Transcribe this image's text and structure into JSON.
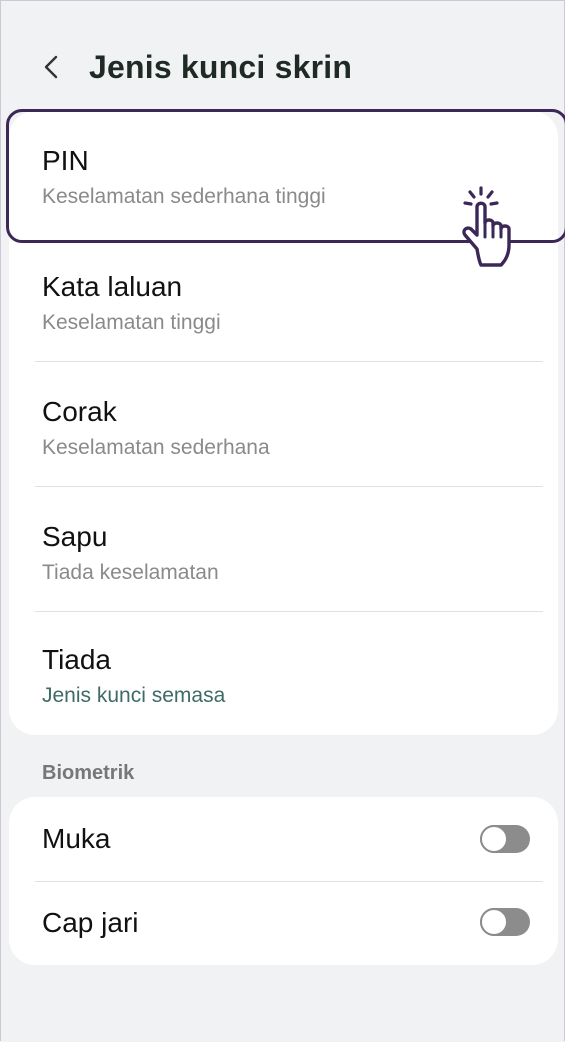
{
  "header": {
    "title": "Jenis kunci skrin",
    "back_icon": "chevron-left-icon"
  },
  "lock_options": [
    {
      "title": "PIN",
      "subtitle": "Keselamatan sederhana tinggi"
    },
    {
      "title": "Kata laluan",
      "subtitle": "Keselamatan tinggi"
    },
    {
      "title": "Corak",
      "subtitle": "Keselamatan sederhana"
    },
    {
      "title": "Sapu",
      "subtitle": "Tiada keselamatan"
    },
    {
      "title": "Tiada",
      "subtitle": "Jenis kunci semasa"
    }
  ],
  "biometric": {
    "section_label": "Biometrik",
    "items": [
      {
        "title": "Muka",
        "enabled": false
      },
      {
        "title": "Cap jari",
        "enabled": false
      }
    ]
  },
  "colors": {
    "accent_subtitle": "#3e6b68",
    "highlight_border": "#3b2856",
    "toggle_off": "#8c8c8c"
  },
  "annotation": {
    "pointer_icon": "hand-pointer-click-icon"
  }
}
